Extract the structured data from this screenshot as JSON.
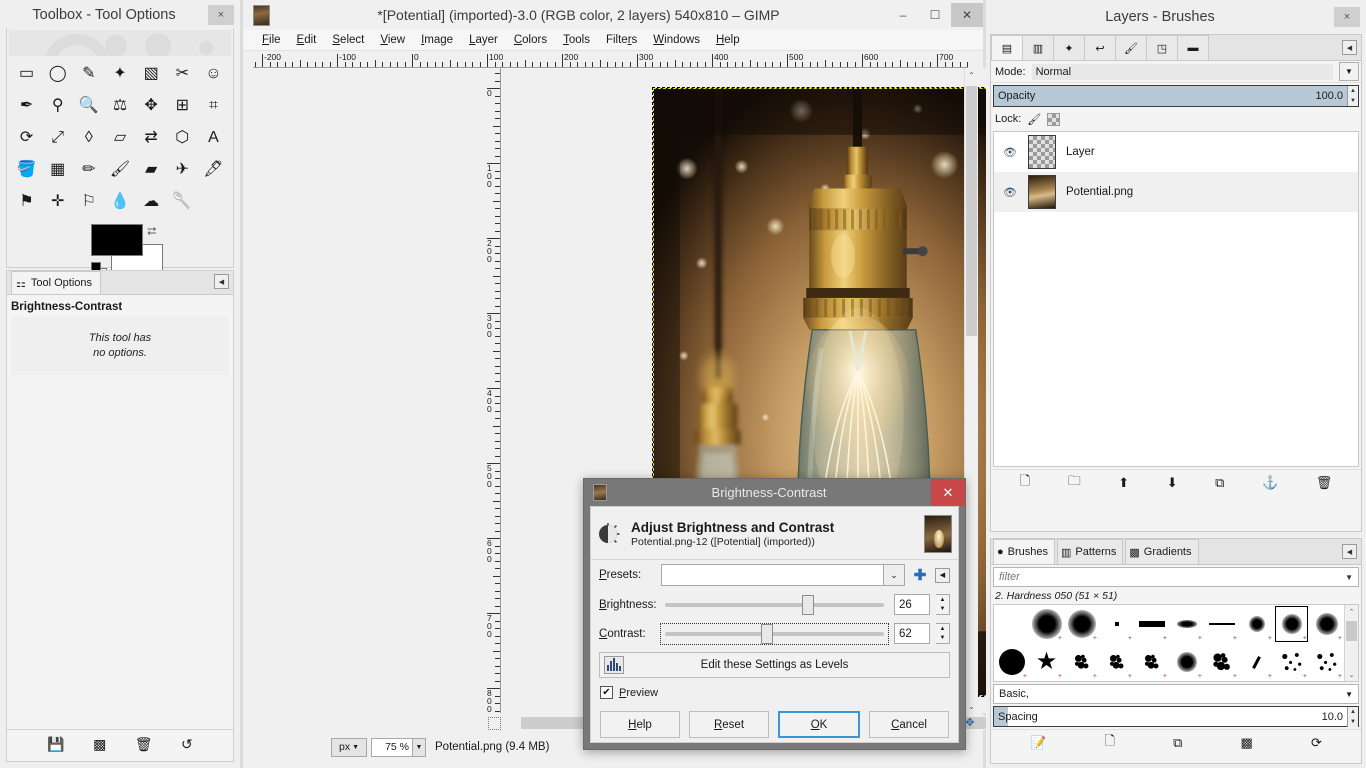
{
  "toolbox": {
    "title": "Toolbox - Tool Options",
    "close_label": "×",
    "tools": [
      {
        "name": "rect-select-tool",
        "glyph": "▭"
      },
      {
        "name": "ellipse-select-tool",
        "glyph": "◯"
      },
      {
        "name": "free-select-tool",
        "glyph": "✎"
      },
      {
        "name": "fuzzy-select-tool",
        "glyph": "✦"
      },
      {
        "name": "select-by-color-tool",
        "glyph": "▧"
      },
      {
        "name": "scissors-select-tool",
        "glyph": "✂"
      },
      {
        "name": "foreground-select-tool",
        "glyph": "☺"
      },
      {
        "name": "paths-tool",
        "glyph": "✒"
      },
      {
        "name": "color-picker-tool",
        "glyph": "⚲"
      },
      {
        "name": "zoom-tool",
        "glyph": "🔍"
      },
      {
        "name": "measure-tool",
        "glyph": "⚖"
      },
      {
        "name": "move-tool",
        "glyph": "✥"
      },
      {
        "name": "alignment-tool",
        "glyph": "⊞"
      },
      {
        "name": "crop-tool",
        "glyph": "⌗"
      },
      {
        "name": "rotate-tool",
        "glyph": "⟳"
      },
      {
        "name": "scale-tool",
        "glyph": "⤢"
      },
      {
        "name": "shear-tool",
        "glyph": "◊"
      },
      {
        "name": "perspective-tool",
        "glyph": "▱"
      },
      {
        "name": "flip-tool",
        "glyph": "⇄"
      },
      {
        "name": "cage-transform-tool",
        "glyph": "⬡"
      },
      {
        "name": "text-tool",
        "glyph": "A"
      },
      {
        "name": "bucket-fill-tool",
        "glyph": "🪣"
      },
      {
        "name": "blend-gradient-tool",
        "glyph": "▦"
      },
      {
        "name": "pencil-tool",
        "glyph": "✏"
      },
      {
        "name": "paintbrush-tool",
        "glyph": "🖌"
      },
      {
        "name": "eraser-tool",
        "glyph": "▰"
      },
      {
        "name": "airbrush-tool",
        "glyph": "✈"
      },
      {
        "name": "ink-tool",
        "glyph": "🖋"
      },
      {
        "name": "clone-tool",
        "glyph": "⚑"
      },
      {
        "name": "heal-tool",
        "glyph": "✛"
      },
      {
        "name": "perspective-clone-tool",
        "glyph": "⚐"
      },
      {
        "name": "blur-sharpen-tool",
        "glyph": "💧"
      },
      {
        "name": "smudge-tool",
        "glyph": "☁"
      },
      {
        "name": "dodge-burn-tool",
        "glyph": "🥄"
      }
    ],
    "colors": {
      "foreground": "#000000",
      "background": "#ffffff"
    },
    "tool_options": {
      "tab_label": "Tool Options",
      "heading": "Brightness-Contrast",
      "empty_line1": "This tool has",
      "empty_line2": "no options.",
      "bottom_buttons": [
        {
          "name": "save-tool-preset",
          "glyph": "💾"
        },
        {
          "name": "restore-tool-preset",
          "glyph": "▩"
        },
        {
          "name": "delete-tool-preset",
          "glyph": "🗑"
        },
        {
          "name": "reset-tool-options",
          "glyph": "↺"
        }
      ]
    }
  },
  "image_window": {
    "title": "*[Potential] (imported)-3.0 (RGB color, 2 layers) 540x810 – GIMP",
    "window_buttons": {
      "minimize": "–",
      "maximize": "☐",
      "close": "✕"
    },
    "menu": [
      {
        "label": "File",
        "accel": "F"
      },
      {
        "label": "Edit",
        "accel": "E"
      },
      {
        "label": "Select",
        "accel": "S"
      },
      {
        "label": "View",
        "accel": "V"
      },
      {
        "label": "Image",
        "accel": "I"
      },
      {
        "label": "Layer",
        "accel": "L"
      },
      {
        "label": "Colors",
        "accel": "C"
      },
      {
        "label": "Tools",
        "accel": "T"
      },
      {
        "label": "Filters",
        "accel": "r"
      },
      {
        "label": "Windows",
        "accel": "W"
      },
      {
        "label": "Help",
        "accel": "H"
      }
    ],
    "ruler_h_labels": [
      "-200",
      "-100",
      "0",
      "100",
      "200",
      "300",
      "400",
      "500",
      "600",
      "700"
    ],
    "ruler_v_labels": [
      "0",
      "100",
      "200",
      "300",
      "400",
      "500",
      "600",
      "700"
    ],
    "status": {
      "unit": "px",
      "zoom": "75 %",
      "text": "Potential.png (9.4 MB)"
    }
  },
  "right_dock": {
    "title": "Layers - Brushes",
    "close_label": "×",
    "tabs": [
      {
        "name": "tab-layers",
        "glyph": "▤",
        "active": true
      },
      {
        "name": "tab-channels",
        "glyph": "▥",
        "active": false
      },
      {
        "name": "tab-paths",
        "glyph": "✦",
        "active": false
      },
      {
        "name": "tab-undo-history",
        "glyph": "↩",
        "active": false
      },
      {
        "name": "tab-brushes",
        "glyph": "🖌",
        "active": false
      },
      {
        "name": "tab-patterns",
        "glyph": "◳",
        "active": false
      },
      {
        "name": "tab-gradients",
        "glyph": "▬",
        "active": false
      }
    ],
    "layers_panel": {
      "mode_label": "Mode:",
      "mode_value": "Normal",
      "opacity_label": "Opacity",
      "opacity_value": "100.0",
      "lock_label": "Lock:",
      "layers": [
        {
          "name": "Layer",
          "thumb": "checker",
          "visible": true,
          "selected": false
        },
        {
          "name": "Potential.png",
          "thumb": "image",
          "visible": true,
          "selected": true
        }
      ],
      "buttons": [
        {
          "name": "new-layer-button",
          "glyph": "🗋"
        },
        {
          "name": "new-layer-group-button",
          "glyph": "🗀"
        },
        {
          "name": "raise-layer-button",
          "glyph": "⬆"
        },
        {
          "name": "lower-layer-button",
          "glyph": "⬇"
        },
        {
          "name": "duplicate-layer-button",
          "glyph": "⧉"
        },
        {
          "name": "anchor-layer-button",
          "glyph": "⚓"
        },
        {
          "name": "delete-layer-button",
          "glyph": "🗑"
        }
      ]
    },
    "brushes_panel": {
      "tabs": [
        {
          "name": "tab-brushes",
          "label": "Brushes",
          "active": true
        },
        {
          "name": "tab-patterns",
          "label": "Patterns",
          "active": false
        },
        {
          "name": "tab-gradients",
          "label": "Gradients",
          "active": false
        }
      ],
      "filter_placeholder": "filter",
      "selected_brush": "2. Hardness 050 (51 × 51)",
      "tag_value": "Basic,",
      "spacing_label": "Spacing",
      "spacing_value": "10.0",
      "buttons": [
        {
          "name": "edit-brush-button",
          "glyph": "📝"
        },
        {
          "name": "new-brush-button",
          "glyph": "🗋"
        },
        {
          "name": "duplicate-brush-button",
          "glyph": "⧉"
        },
        {
          "name": "delete-brush-button",
          "glyph": "▩"
        },
        {
          "name": "refresh-brushes-button",
          "glyph": "⟳"
        }
      ]
    }
  },
  "dialog": {
    "title": "Brightness-Contrast",
    "close_label": "✕",
    "heading": "Adjust Brightness and Contrast",
    "subheading": "Potential.png-12 ([Potential] (imported))",
    "presets_label": "Presets:",
    "presets_value": "",
    "brightness_label": "Brightness:",
    "brightness_value": "26",
    "contrast_label": "Contrast:",
    "contrast_value": "62",
    "levels_button": "Edit these Settings as Levels",
    "preview_label": "Preview",
    "preview_checked": true,
    "buttons": [
      {
        "name": "help-button",
        "label": "Help",
        "default": false
      },
      {
        "name": "reset-button",
        "label": "Reset",
        "default": false
      },
      {
        "name": "ok-button",
        "label": "OK",
        "default": true
      },
      {
        "name": "cancel-button",
        "label": "Cancel",
        "default": false
      }
    ]
  }
}
